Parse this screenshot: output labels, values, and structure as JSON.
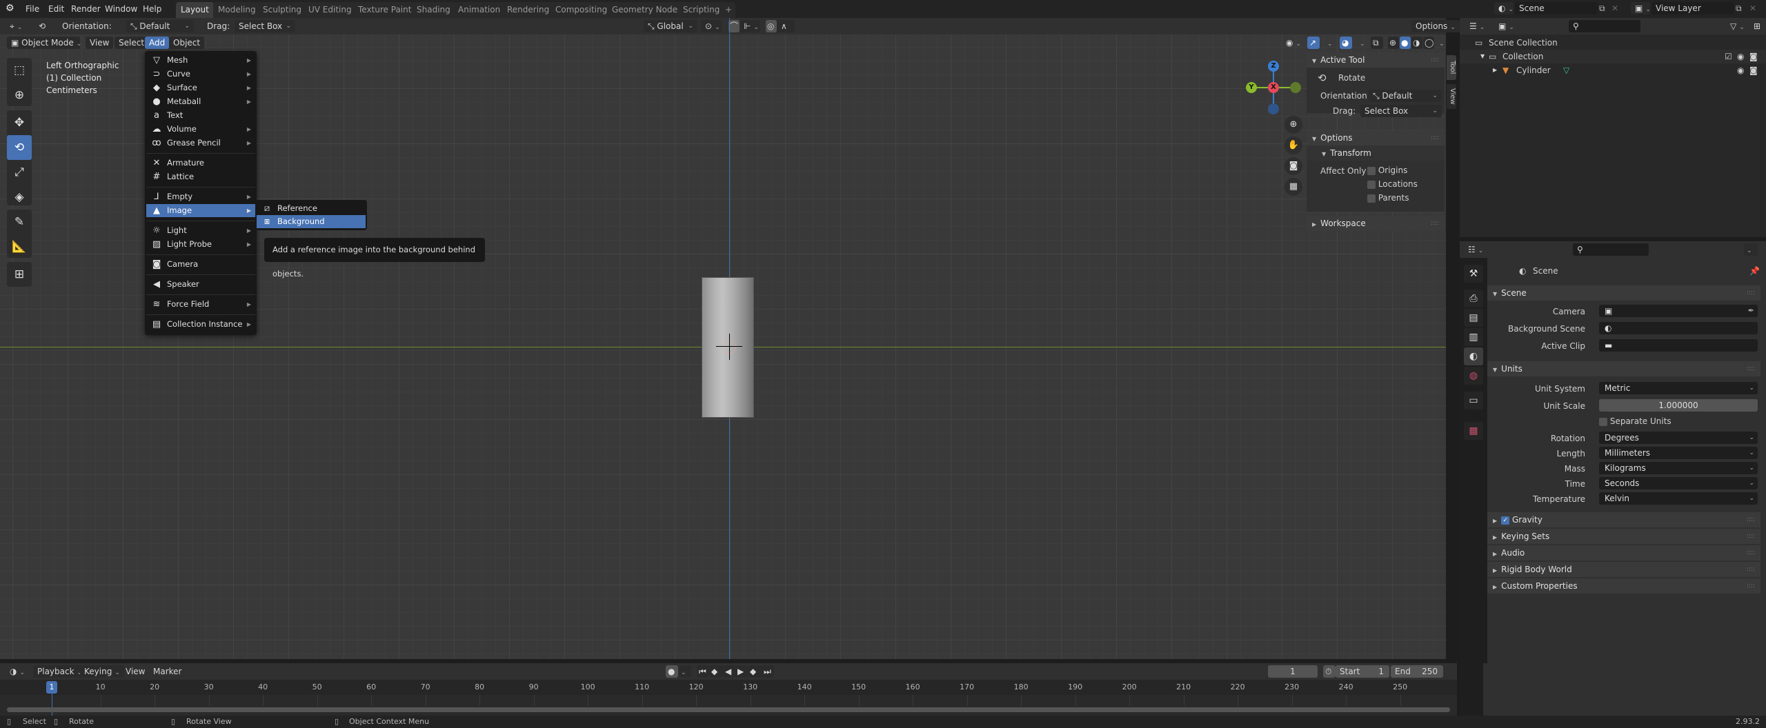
{
  "app": {
    "version": "2.93.2"
  },
  "topbar": {
    "menus": [
      "File",
      "Edit",
      "Render",
      "Window",
      "Help"
    ],
    "workspaces": [
      "Layout",
      "Modeling",
      "Sculpting",
      "UV Editing",
      "Texture Paint",
      "Shading",
      "Animation",
      "Rendering",
      "Compositing",
      "Geometry Nodes",
      "Scripting"
    ],
    "active_workspace": "Layout",
    "add_workspace": "+",
    "scene_name": "Scene",
    "view_layer": "View Layer"
  },
  "tool_header": {
    "orientation_label": "Orientation:",
    "orientation_value": "Default",
    "drag_label": "Drag:",
    "drag_value": "Select Box",
    "transform_orientation": "Global",
    "options_label": "Options"
  },
  "viewport_header": {
    "mode": "Object Mode",
    "menus": [
      "View",
      "Select",
      "Add",
      "Object"
    ],
    "active_menu": "Add"
  },
  "viewport_overlay": {
    "view_name": "Left Orthographic",
    "collection": "(1) Collection",
    "units": "Centimeters"
  },
  "toolbar": {
    "tools": [
      {
        "name": "select-box",
        "icon": "select-box-icon"
      },
      {
        "name": "cursor",
        "icon": "cursor-icon"
      },
      {
        "name": "move",
        "icon": "move-icon"
      },
      {
        "name": "rotate",
        "icon": "rotate-icon",
        "active": true
      },
      {
        "name": "scale",
        "icon": "scale-icon"
      },
      {
        "name": "transform",
        "icon": "transform-icon"
      },
      {
        "name": "annotate",
        "icon": "annotate-icon"
      },
      {
        "name": "measure",
        "icon": "measure-icon"
      },
      {
        "name": "add-cube",
        "icon": "add-cube-icon"
      }
    ]
  },
  "add_menu": {
    "items": [
      {
        "label": "Mesh",
        "icon": "▽",
        "submenu": true
      },
      {
        "label": "Curve",
        "icon": "⊃",
        "submenu": true
      },
      {
        "label": "Surface",
        "icon": "◆",
        "submenu": true
      },
      {
        "label": "Metaball",
        "icon": "●",
        "submenu": true
      },
      {
        "label": "Text",
        "icon": "a",
        "submenu": false
      },
      {
        "label": "Volume",
        "icon": "☁",
        "submenu": true
      },
      {
        "label": "Grease Pencil",
        "icon": "ꝏ",
        "submenu": true
      },
      {
        "label": "Armature",
        "icon": "✕",
        "submenu": false
      },
      {
        "label": "Lattice",
        "icon": "#",
        "submenu": false
      },
      {
        "label": "Empty",
        "icon": "⅃",
        "submenu": true
      },
      {
        "label": "Image",
        "icon": "▲",
        "submenu": true,
        "highlighted": true
      },
      {
        "label": "Light",
        "icon": "☼",
        "submenu": true
      },
      {
        "label": "Light Probe",
        "icon": "▨",
        "submenu": true
      },
      {
        "label": "Camera",
        "icon": "◙",
        "submenu": false
      },
      {
        "label": "Speaker",
        "icon": "◀",
        "submenu": false
      },
      {
        "label": "Force Field",
        "icon": "≋",
        "submenu": true
      },
      {
        "label": "Collection Instance",
        "icon": "▤",
        "submenu": true
      }
    ],
    "image_submenu": [
      {
        "label": "Reference",
        "icon": "reference-image-icon"
      },
      {
        "label": "Background",
        "icon": "background-image-icon",
        "highlighted": true
      }
    ],
    "tooltip": "Add a reference image into the background behind objects."
  },
  "gizmo": {
    "z": "Z",
    "y": "Y",
    "x": "X"
  },
  "npanel": {
    "tabs": [
      "Tool",
      "View"
    ],
    "active_tool_title": "Active Tool",
    "tool_name": "Rotate",
    "orientation_label": "Orientation",
    "orientation_value": "Default",
    "drag_label": "Drag:",
    "drag_value": "Select Box",
    "options_title": "Options",
    "transform_title": "Transform",
    "affect_only_label": "Affect Only",
    "affect_only": [
      {
        "label": "Origins",
        "checked": false
      },
      {
        "label": "Locations",
        "checked": false
      },
      {
        "label": "Parents",
        "checked": false
      }
    ],
    "workspace_title": "Workspace"
  },
  "outliner": {
    "root": "Scene Collection",
    "collection": "Collection",
    "object": "Cylinder"
  },
  "properties": {
    "context": "Scene",
    "scene_section": "Scene",
    "camera_label": "Camera",
    "background_scene_label": "Background Scene",
    "active_clip_label": "Active Clip",
    "units_section": "Units",
    "unit_system_label": "Unit System",
    "unit_system": "Metric",
    "unit_scale_label": "Unit Scale",
    "unit_scale": "1.000000",
    "separate_units": "Separate Units",
    "rotation_label": "Rotation",
    "rotation": "Degrees",
    "length_label": "Length",
    "length": "Millimeters",
    "mass_label": "Mass",
    "mass": "Kilograms",
    "time_label": "Time",
    "time": "Seconds",
    "temperature_label": "Temperature",
    "temperature": "Kelvin",
    "collapsed_sections": [
      "Gravity",
      "Keying Sets",
      "Audio",
      "Rigid Body World",
      "Custom Properties"
    ],
    "gravity_enabled": true
  },
  "timeline": {
    "menus": [
      "Playback",
      "Keying",
      "View",
      "Marker"
    ],
    "current_frame": "1",
    "start_label": "Start",
    "start": "1",
    "end_label": "End",
    "end": "250",
    "ticks": [
      "10",
      "20",
      "30",
      "40",
      "50",
      "60",
      "70",
      "80",
      "90",
      "100",
      "110",
      "120",
      "130",
      "140",
      "150",
      "160",
      "170",
      "180",
      "190",
      "200",
      "210",
      "220",
      "230",
      "240",
      "250"
    ]
  },
  "statusbar": {
    "select": "Select",
    "rotate": "Rotate",
    "rotate_view": "Rotate View",
    "context_menu": "Object Context Menu"
  },
  "colors": {
    "accent": "#4772b3",
    "x_axis": "#e5495b",
    "y_axis": "#8bba2b",
    "z_axis": "#3a7fd4"
  }
}
